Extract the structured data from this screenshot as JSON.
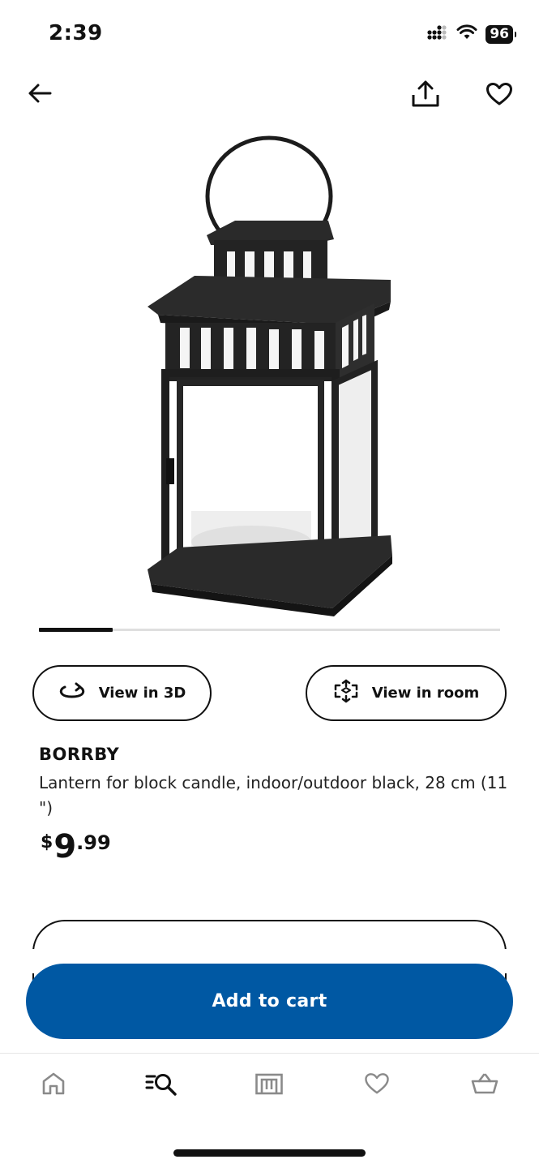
{
  "status_bar": {
    "time": "2:39",
    "battery": "96",
    "icons": [
      "signal-icon",
      "wifi-icon",
      "battery-icon"
    ]
  },
  "header": {
    "icons": [
      "back-arrow-icon",
      "share-icon",
      "heart-icon"
    ]
  },
  "product_image": {
    "subject": "lantern",
    "carousel_progress": 0.16
  },
  "actions": {
    "view_3d_label": "View in 3D",
    "view_room_label": "View in room"
  },
  "product": {
    "name": "BORRBY",
    "description": "Lantern for block candle, indoor/outdoor black, 28 cm (11 \")",
    "price": {
      "currency": "$",
      "whole": "9",
      "decimal": ".99"
    }
  },
  "cart": {
    "add_label": "Add to cart"
  },
  "tab_bar": {
    "items": [
      {
        "icon": "home-icon"
      },
      {
        "icon": "search-icon",
        "active": true
      },
      {
        "icon": "store-icon"
      },
      {
        "icon": "heart-icon"
      },
      {
        "icon": "basket-icon"
      }
    ]
  },
  "colors": {
    "primary_blue": "#0058a3",
    "text": "#111111",
    "muted_icon": "#8a8a8a"
  }
}
